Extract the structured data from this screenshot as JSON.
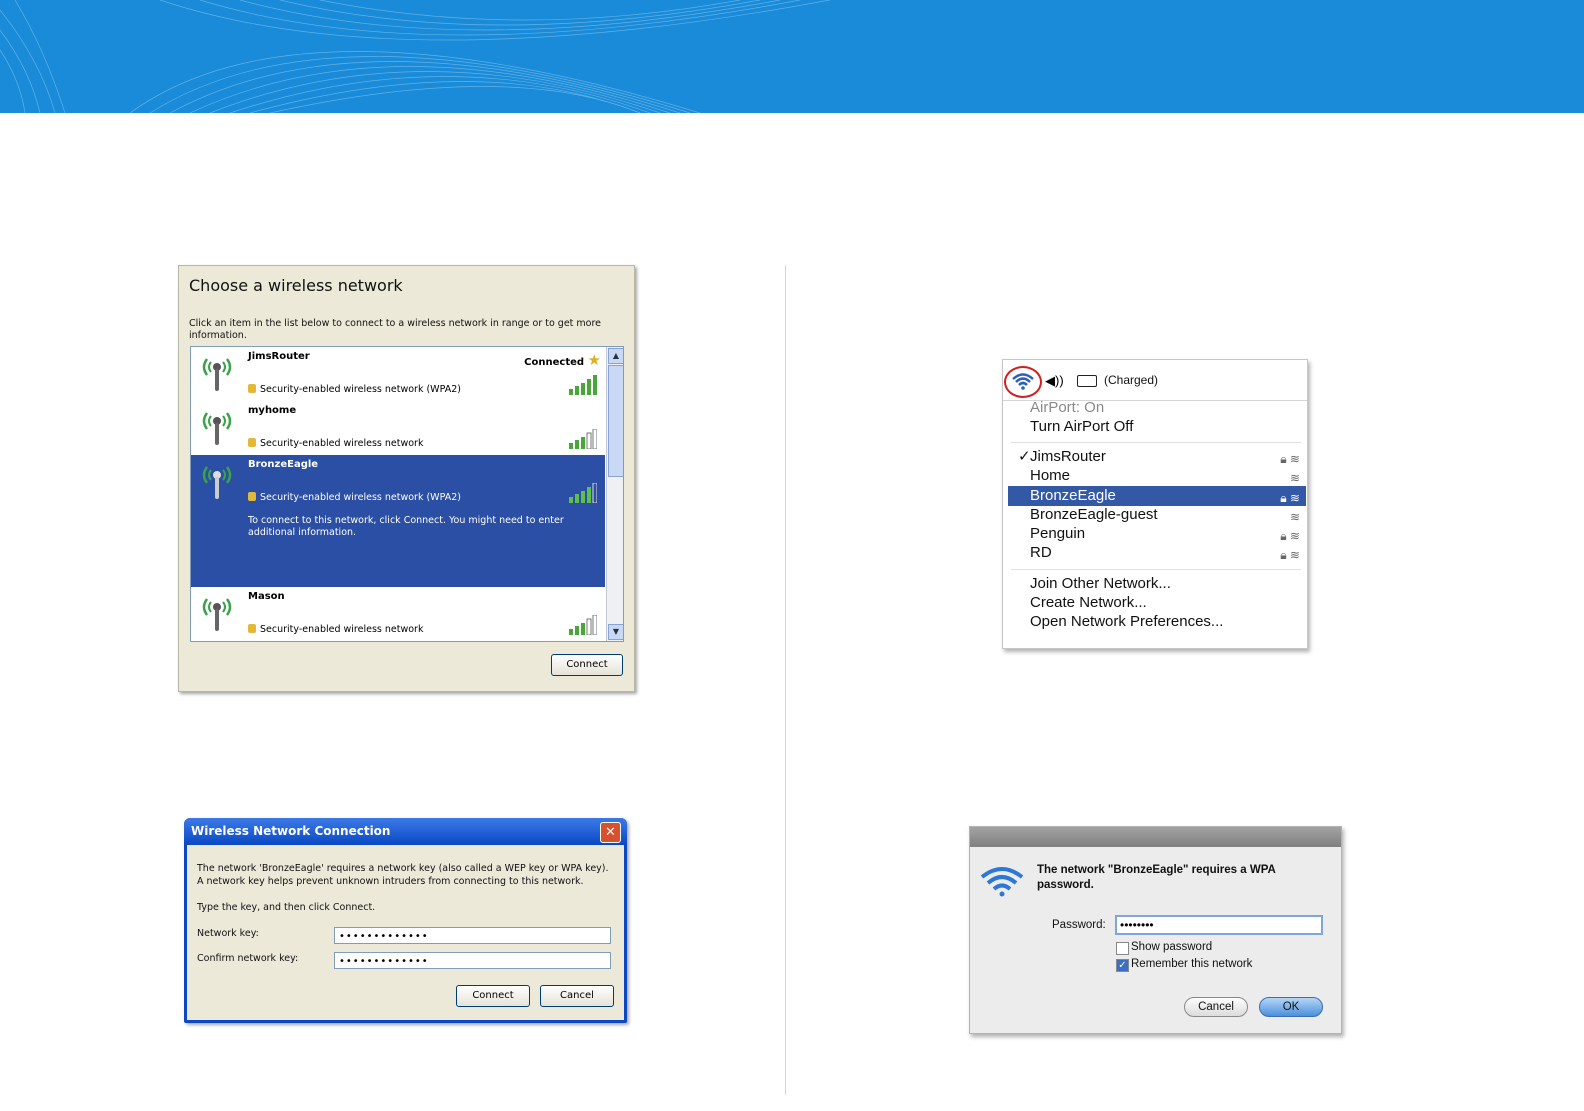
{
  "colors": {
    "banner": "#1a8bd8",
    "xp_selected": "#2b4fa4",
    "mac_highlight": "#3358a6",
    "airport_ring": "#d21f1f"
  },
  "xp_choose": {
    "title": "Choose a wireless network",
    "description": "Click an item in the list below to connect to a wireless network in range or to get more information.",
    "networks": [
      {
        "name": "JimsRouter",
        "security": "Security-enabled wireless network (WPA2)",
        "status": "Connected",
        "signal": 5
      },
      {
        "name": "myhome",
        "security": "Security-enabled wireless network",
        "status": "",
        "signal": 3
      },
      {
        "name": "BronzeEagle",
        "security": "Security-enabled wireless network (WPA2)",
        "status": "",
        "signal": 4,
        "extra": "To connect to this network, click Connect. You might need to enter additional information."
      },
      {
        "name": "Mason",
        "security": "Security-enabled wireless network",
        "status": "",
        "signal": 3
      }
    ],
    "connect_label": "Connect"
  },
  "xp_connection": {
    "title": "Wireless Network Connection",
    "message": "The network 'BronzeEagle' requires a network key (also called a WEP key or WPA key). A network key helps prevent unknown intruders from connecting to this network.",
    "instruction": "Type the key, and then click Connect.",
    "network_key_label": "Network key:",
    "network_key_value": "•••••••••••••",
    "confirm_key_label": "Confirm network key:",
    "confirm_key_value": "•••••••••••••",
    "connect_label": "Connect",
    "cancel_label": "Cancel"
  },
  "mac_menu": {
    "battery_status": "(Charged)",
    "airport_status": "AirPort: On",
    "toggle_label": "Turn AirPort Off",
    "networks": [
      {
        "name": "JimsRouter",
        "checked": true,
        "locked": true
      },
      {
        "name": "Home",
        "checked": false,
        "locked": false
      },
      {
        "name": "BronzeEagle",
        "checked": false,
        "locked": true,
        "highlighted": true
      },
      {
        "name": "BronzeEagle-guest",
        "checked": false,
        "locked": false
      },
      {
        "name": "Penguin",
        "checked": false,
        "locked": true
      },
      {
        "name": "RD",
        "checked": false,
        "locked": true
      }
    ],
    "actions": [
      "Join Other Network...",
      "Create Network...",
      "Open Network Preferences..."
    ]
  },
  "mac_password": {
    "message": "The network \"BronzeEagle\" requires a WPA password.",
    "password_label": "Password:",
    "password_value": "••••••••",
    "show_password_label": "Show password",
    "remember_label": "Remember this network",
    "remember_checked": true,
    "cancel_label": "Cancel",
    "ok_label": "OK"
  }
}
